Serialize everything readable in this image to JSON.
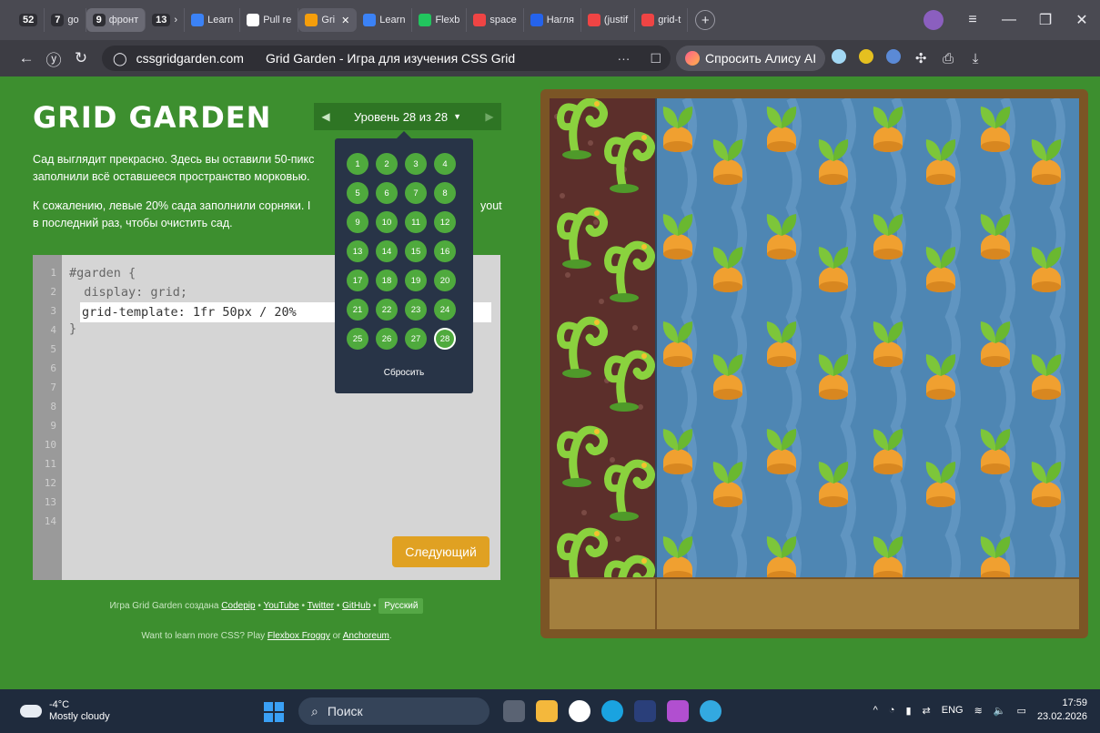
{
  "browser": {
    "tabs": [
      {
        "label": "52",
        "kind": "count"
      },
      {
        "label": "7",
        "extra": "go",
        "kind": "group"
      },
      {
        "label": "9",
        "extra": "фронт",
        "kind": "group",
        "active": true
      },
      {
        "label": "13",
        "extra": "›",
        "kind": "group"
      },
      {
        "label": "Learn",
        "fav": "#3b82f6"
      },
      {
        "label": "Pull re",
        "fav": "#ffffff"
      },
      {
        "label": "Gri",
        "fav": "#f59e0b",
        "current": true
      },
      {
        "label": "Learn",
        "fav": "#3b82f6"
      },
      {
        "label": "Flexb",
        "fav": "#22c55e"
      },
      {
        "label": "space",
        "fav": "#ef4444"
      },
      {
        "label": "Нагля",
        "fav": "#2563eb"
      },
      {
        "label": "(justif",
        "fav": "#ef4444"
      },
      {
        "label": "grid-t",
        "fav": "#ef4444"
      }
    ],
    "url_domain": "cssgridgarden.com",
    "page_title": "Grid Garden - Игра для изучения CSS Grid",
    "alice_label": "Спросить Алису AI"
  },
  "page": {
    "logo": "GRID GARDEN",
    "level_label": "Уровень 28 из 28",
    "description_p1": "Сад выглядит прекрасно. Здесь вы оставили 50-пикс",
    "description_p1b": "заполнили всё оставшееся пространство морковью.",
    "description_p2": "К сожалению, левые 20% сада заполнили сорняки. I",
    "description_p2_tail": "yout",
    "description_p2b": "в последний раз, чтобы очистить сад.",
    "code_lines": [
      "#garden {",
      "  display: grid;",
      "",
      "}"
    ],
    "user_code": "grid-template: 1fr 50px / 20%",
    "line_numbers": [
      "1",
      "2",
      "3",
      "4",
      "5",
      "6",
      "7",
      "8",
      "9",
      "10",
      "11",
      "12",
      "13",
      "14"
    ],
    "next_button": "Следующий",
    "credits_prefix": "Игра Grid Garden создана",
    "credits_links": [
      "Codepip",
      "YouTube",
      "Twitter",
      "GitHub"
    ],
    "language": "Русский",
    "more_prefix": "Want to learn more CSS? Play",
    "more_link1": "Flexbox Froggy",
    "more_or": "or",
    "more_link2": "Anchoreum",
    "more_suffix": "."
  },
  "dropdown": {
    "levels": [
      "1",
      "2",
      "3",
      "4",
      "5",
      "6",
      "7",
      "8",
      "9",
      "10",
      "11",
      "12",
      "13",
      "14",
      "15",
      "16",
      "17",
      "18",
      "19",
      "20",
      "21",
      "22",
      "23",
      "24",
      "25",
      "26",
      "27",
      "28"
    ],
    "current_level": "28",
    "reset_label": "Сбросить"
  },
  "garden": {
    "weed_fraction": 0.2,
    "soil_row": "50px",
    "colors": {
      "weeds": "#5c2f2b",
      "water": "#4e86b3",
      "soil": "#a37f3e",
      "frame": "#7b5525",
      "carrot": "#f0a030",
      "leaf": "#7dc63a"
    }
  },
  "taskbar": {
    "temperature": "-4°C",
    "weather": "Mostly cloudy",
    "search_placeholder": "Поиск",
    "lang": "ENG",
    "time": "17:59",
    "date": "23.02.2026"
  }
}
